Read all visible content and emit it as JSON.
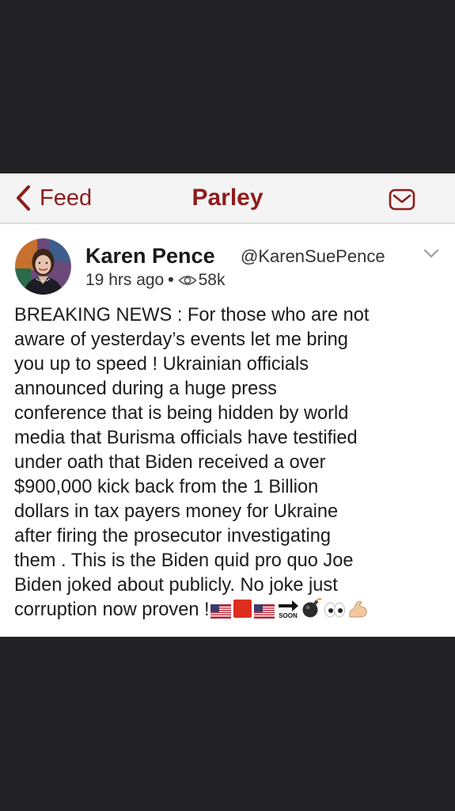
{
  "navbar": {
    "back_label": "Feed",
    "title": "Parley",
    "accent_color": "#8e1c1c",
    "icons": [
      "chevron-left-icon",
      "mail-icon"
    ]
  },
  "post": {
    "author_name": "Karen Pence",
    "author_handle": "@KarenSuePence",
    "time_ago": "19 hrs ago",
    "separator": "•",
    "views": "58k",
    "body": "BREAKING NEWS : For those who are not\naware of yesterday’s events let me bring\nyou up to speed ! Ukrainian officials\nannounced during a huge press\nconference that is being hidden by world\nmedia that Burisma officials have testified\nunder oath that Biden received a over\n$900,000 kick back from the 1 Billion\ndollars in tax payers money for Ukraine\nafter firing the prosecutor investigating\nthem . This is the Biden quid pro quo Joe\nBiden joked about publicly. No joke just\ncorruption now proven !",
    "emojis": [
      "us-flag",
      "red-square",
      "us-flag",
      "soon-arrow",
      "bomb",
      "eyes",
      "flexed-biceps"
    ],
    "soon_label": "SOON"
  }
}
